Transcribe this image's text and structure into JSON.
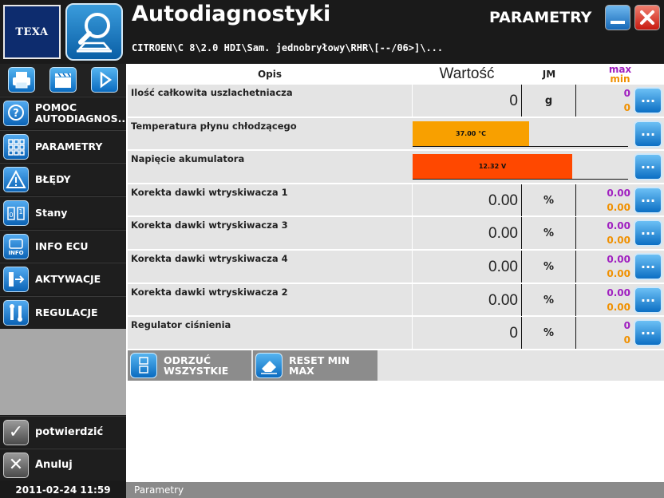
{
  "header": {
    "logo_text": "TEXA",
    "title": "Autodiagnostyki",
    "breadcrumb": "CITROEN\\C 8\\2.0 HDI\\Sam. jednobryłowy\\RHR\\[--/06>]\\...",
    "section": "PARAMETRY",
    "icons": {
      "app": "magnifier-car-icon",
      "minimize": "minimize-icon",
      "close": "close-icon"
    }
  },
  "toolbar": {
    "icons": [
      "printer-icon",
      "clapperboard-icon",
      "play-icon"
    ]
  },
  "sidebar": {
    "items": [
      {
        "label": "POMOC AUTODIAGNOS...",
        "icon": "help-icon"
      },
      {
        "label": "PARAMETRY",
        "icon": "grid-icon"
      },
      {
        "label": "BŁĘDY",
        "icon": "warning-icon"
      },
      {
        "label": "Stany",
        "icon": "switch-icon"
      },
      {
        "label": "INFO ECU",
        "icon": "info-icon"
      },
      {
        "label": "AKTYWACJE",
        "icon": "activation-icon"
      },
      {
        "label": "REGULACJE",
        "icon": "tools-icon"
      }
    ],
    "actions": [
      {
        "label": "potwierdzić",
        "icon": "checkmark-icon"
      },
      {
        "label": "Anuluj",
        "icon": "cancel-icon"
      }
    ]
  },
  "table": {
    "headers": {
      "name": "Opis",
      "value": "Wartość",
      "unit": "JM",
      "max": "max",
      "min": "min"
    },
    "rows": [
      {
        "name": "Ilość całkowita uszlachetniacza",
        "value": "0",
        "unit": "g",
        "max": "0",
        "min": "0"
      },
      {
        "name": "Temperatura płynu chłodzącego",
        "bar_text": "37.00 °C",
        "bar_fraction": 0.54,
        "bar_color": "#f8a000"
      },
      {
        "name": "Napięcie akumulatora",
        "bar_text": "12.32 V",
        "bar_fraction": 0.74,
        "bar_color": "#ff4800"
      },
      {
        "name": "Korekta dawki wtryskiwacza 1",
        "value": "0.00",
        "unit": "%",
        "max": "0.00",
        "min": "0.00"
      },
      {
        "name": "Korekta dawki wtryskiwacza 3",
        "value": "0.00",
        "unit": "%",
        "max": "0.00",
        "min": "0.00"
      },
      {
        "name": "Korekta dawki wtryskiwacza 4",
        "value": "0.00",
        "unit": "%",
        "max": "0.00",
        "min": "0.00"
      },
      {
        "name": "Korekta dawki wtryskiwacza 2",
        "value": "0.00",
        "unit": "%",
        "max": "0.00",
        "min": "0.00"
      },
      {
        "name": "Regulator ciśnienia",
        "value": "0",
        "unit": "%",
        "max": "0",
        "min": "0"
      }
    ],
    "row_button_label": "..."
  },
  "footer": {
    "discard_all": "ODRZUĆ WSZYSTKIE",
    "reset_min_max": "RESET MIN MAX"
  },
  "status": {
    "datetime": "2011-02-24  11:59",
    "text": "Parametry"
  },
  "colors": {
    "max": "#a020c0",
    "min": "#f09000",
    "accent": "#0a6bc0"
  }
}
